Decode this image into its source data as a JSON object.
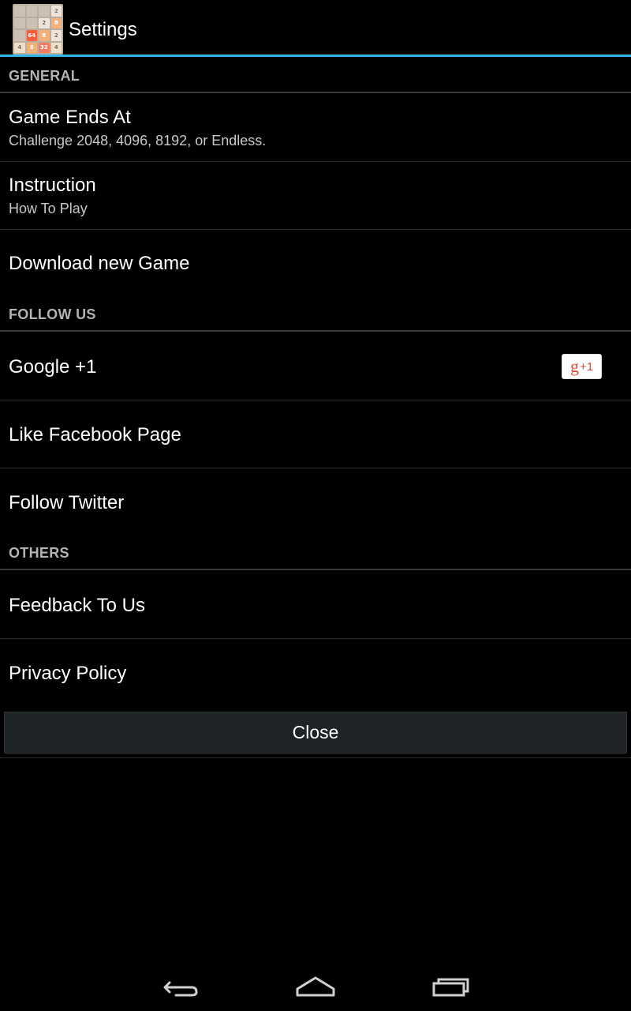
{
  "action_bar": {
    "title": "Settings",
    "app_icon_tiles": [
      "",
      "",
      "",
      "2",
      "",
      "",
      "2",
      "8",
      "",
      "64",
      "8",
      "2",
      "4",
      "8",
      "32",
      "4"
    ]
  },
  "sections": {
    "general": "GENERAL",
    "follow_us": "FOLLOW US",
    "others": "OTHERS"
  },
  "prefs": {
    "game_ends_at": {
      "title": "Game Ends At",
      "summary": "Challenge 2048, 4096, 8192, or Endless."
    },
    "instruction": {
      "title": "Instruction",
      "summary": "How To Play"
    },
    "download_new_game": {
      "title": "Download new Game"
    },
    "google_plus": {
      "title": "Google +1",
      "badge_g": "g",
      "badge_plus": "+1"
    },
    "facebook": {
      "title": "Like Facebook Page"
    },
    "twitter": {
      "title": "Follow Twitter"
    },
    "feedback": {
      "title": "Feedback To Us"
    },
    "privacy": {
      "title": "Privacy Policy"
    }
  },
  "close_button": {
    "label": "Close"
  },
  "nav": {
    "back_icon": "back-icon",
    "home_icon": "home-icon",
    "recents_icon": "recents-icon"
  },
  "colors": {
    "accent": "#33b5e5",
    "background": "#000000",
    "google_red": "#dd4b39"
  }
}
